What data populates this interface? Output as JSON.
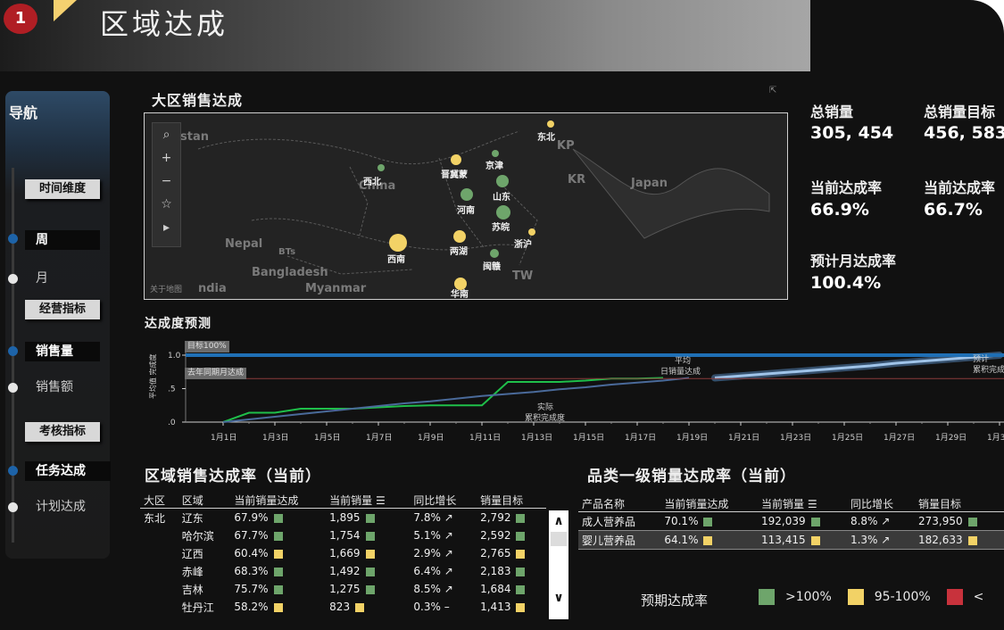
{
  "header": {
    "badge": "1",
    "title": "区域达成"
  },
  "nav": {
    "title": "导航",
    "groups": [
      {
        "label": "时间维度",
        "options": [
          "周",
          "月"
        ]
      },
      {
        "label": "经营指标",
        "options": [
          "销售量",
          "销售额"
        ]
      },
      {
        "label": "考核指标",
        "options": [
          "任务达成",
          "计划达成"
        ]
      }
    ]
  },
  "map": {
    "title": "大区销售达成",
    "country_labels": [
      "stan",
      "China",
      "Nepal",
      "Bangladesh",
      "Myanmar",
      "ndia",
      "KP",
      "KR",
      "Japan",
      "TW",
      "BTs"
    ],
    "regions": [
      "东北",
      "西北",
      "晋冀蒙",
      "京津",
      "山东",
      "河南",
      "苏皖",
      "浙沪",
      "西南",
      "两湖",
      "闽赣",
      "华南"
    ],
    "attribution": "关于地图"
  },
  "kpis": {
    "total_sales_label": "总销量",
    "total_sales_value": "305, 454",
    "total_target_label": "总销量目标",
    "total_target_value": "456, 583",
    "current_rate_label": "当前达成率",
    "current_rate_value": "66.9%",
    "current_rate2_label": "当前达成率",
    "current_rate2_value": "66.7%",
    "forecast_label": "预计月达成率",
    "forecast_value": "100.4%"
  },
  "forecast": {
    "title": "达成度预测",
    "ylabel": "平均值 完成度",
    "target_tag": "目标100%",
    "last_year_tag": "去年同期月达成",
    "ann_avg": "平均",
    "ann_daily": "日销量达成",
    "ann_actual": "实际",
    "ann_cum": "累积完成度",
    "ann_fc1": "预计",
    "ann_fc2": "累积完成",
    "y_ticks": [
      "1.0",
      ".5",
      ".0"
    ],
    "x_ticks": [
      "1月1日",
      "1月3日",
      "1月5日",
      "1月7日",
      "1月9日",
      "1月11日",
      "1月13日",
      "1月15日",
      "1月17日",
      "1月19日",
      "1月21日",
      "1月23日",
      "1月25日",
      "1月27日",
      "1月29日",
      "1月3"
    ]
  },
  "chart_data": {
    "type": "line",
    "title": "达成度预测",
    "ylabel": "平均值 完成度",
    "x": [
      "1月1日",
      "1月2日",
      "1月3日",
      "1月4日",
      "1月5日",
      "1月6日",
      "1月7日",
      "1月8日",
      "1月9日",
      "1月10日",
      "1月11日",
      "1月12日",
      "1月13日",
      "1月14日",
      "1月15日",
      "1月16日",
      "1月17日",
      "1月18日",
      "1月19日",
      "1月20日",
      "1月21日",
      "1月22日",
      "1月23日",
      "1月24日",
      "1月25日",
      "1月26日",
      "1月27日",
      "1月28日",
      "1月29日",
      "1月30日",
      "1月31日"
    ],
    "series": [
      {
        "name": "实际",
        "values": [
          0.0,
          0.14,
          0.14,
          0.2,
          0.2,
          0.2,
          0.22,
          0.24,
          0.25,
          0.25,
          0.25,
          0.6,
          0.6,
          0.6,
          0.62,
          0.65,
          0.65,
          0.66,
          null,
          null,
          null,
          null,
          null,
          null,
          null,
          null,
          null,
          null,
          null,
          null,
          null
        ]
      },
      {
        "name": "累积完成度",
        "values": [
          0.0,
          0.04,
          0.08,
          0.12,
          0.16,
          0.2,
          0.24,
          0.28,
          0.31,
          0.35,
          0.39,
          0.42,
          0.45,
          0.49,
          0.52,
          0.56,
          0.59,
          0.62,
          0.66,
          null,
          null,
          null,
          null,
          null,
          null,
          null,
          null,
          null,
          null,
          null,
          null
        ]
      },
      {
        "name": "预计累积完成",
        "values": [
          null,
          null,
          null,
          null,
          null,
          null,
          null,
          null,
          null,
          null,
          null,
          null,
          null,
          null,
          null,
          null,
          null,
          null,
          null,
          0.66,
          0.69,
          0.72,
          0.75,
          0.78,
          0.81,
          0.84,
          0.88,
          0.91,
          0.94,
          0.97,
          1.0
        ]
      },
      {
        "name": "目标100%",
        "values": [
          1,
          1,
          1,
          1,
          1,
          1,
          1,
          1,
          1,
          1,
          1,
          1,
          1,
          1,
          1,
          1,
          1,
          1,
          1,
          1,
          1,
          1,
          1,
          1,
          1,
          1,
          1,
          1,
          1,
          1,
          1
        ]
      },
      {
        "name": "去年同期月达成",
        "values": [
          0.65,
          0.65,
          0.65,
          0.65,
          0.65,
          0.65,
          0.65,
          0.65,
          0.65,
          0.65,
          0.65,
          0.65,
          0.65,
          0.65,
          0.65,
          0.65,
          0.65,
          0.65,
          0.65,
          0.65,
          0.65,
          0.65,
          0.65,
          0.65,
          0.65,
          0.65,
          0.65,
          0.65,
          0.65,
          0.65,
          0.65
        ]
      }
    ],
    "ylim": [
      0,
      1.0
    ]
  },
  "region_table": {
    "title": "区域销售达成率（当前）",
    "columns": [
      "大区",
      "区域",
      "当前销量达成",
      "当前销量",
      "同比增长",
      "销量目标"
    ],
    "rows": [
      {
        "zone": "东北",
        "area": "辽东",
        "rate": "67.9%",
        "rate_c": "g",
        "sales": "1,895",
        "sales_c": "g",
        "yoy": "7.8%",
        "trend": "↗",
        "target": "2,792",
        "target_c": "g"
      },
      {
        "zone": "",
        "area": "哈尔滨",
        "rate": "67.7%",
        "rate_c": "g",
        "sales": "1,754",
        "sales_c": "g",
        "yoy": "5.1%",
        "trend": "↗",
        "target": "2,592",
        "target_c": "g"
      },
      {
        "zone": "",
        "area": "辽西",
        "rate": "60.4%",
        "rate_c": "y",
        "sales": "1,669",
        "sales_c": "y",
        "yoy": "2.9%",
        "trend": "↗",
        "target": "2,765",
        "target_c": "y"
      },
      {
        "zone": "",
        "area": "赤峰",
        "rate": "68.3%",
        "rate_c": "g",
        "sales": "1,492",
        "sales_c": "g",
        "yoy": "6.4%",
        "trend": "↗",
        "target": "2,183",
        "target_c": "g"
      },
      {
        "zone": "",
        "area": "吉林",
        "rate": "75.7%",
        "rate_c": "g",
        "sales": "1,275",
        "sales_c": "g",
        "yoy": "8.5%",
        "trend": "↗",
        "target": "1,684",
        "target_c": "g"
      },
      {
        "zone": "",
        "area": "牡丹江",
        "rate": "58.2%",
        "rate_c": "y",
        "sales": "823",
        "sales_c": "y",
        "yoy": "0.3%",
        "trend": "–",
        "target": "1,413",
        "target_c": "y"
      }
    ]
  },
  "category_table": {
    "title": "品类一级销量达成率（当前）",
    "columns": [
      "产品名称",
      "当前销量达成",
      "当前销量",
      "同比增长",
      "销量目标"
    ],
    "rows": [
      {
        "name": "成人营养品",
        "rate": "70.1%",
        "rate_c": "g",
        "sales": "192,039",
        "sales_c": "g",
        "yoy": "8.8%",
        "trend": "↗",
        "target": "273,950",
        "target_c": "g"
      },
      {
        "name": "婴儿营养品",
        "rate": "64.1%",
        "rate_c": "y",
        "sales": "113,415",
        "sales_c": "y",
        "yoy": "1.3%",
        "trend": "↗",
        "target": "182,633",
        "target_c": "y"
      }
    ]
  },
  "status_legend": {
    "label": "预期达成率",
    "items": [
      {
        "text": ">100%",
        "color": "#6ea56b"
      },
      {
        "text": "95-100%",
        "color": "#f2d266"
      },
      {
        "text": "<",
        "color": "#c8323c"
      }
    ]
  },
  "colors": {
    "green": "#6ea56b",
    "yellow": "#f2d266",
    "red": "#c8323c",
    "target_line": "#1f6fb5",
    "actual_line": "#1fbf4a",
    "cum_line": "#4a6a9a"
  }
}
